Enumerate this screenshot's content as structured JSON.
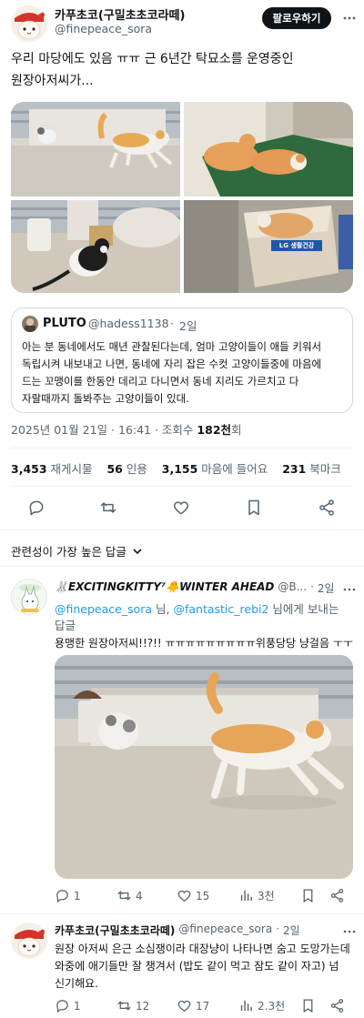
{
  "tweet": {
    "author_name": "카푸초코(구밀초초코라떼)",
    "author_handle": "@finepeace_sora",
    "follow_label": "팔로우하기",
    "text_line1": "우리 마당에도 있음 ㅠㅠ 근 6년간 탁묘소를 운영중인",
    "text_line2": "원장아저씨가...",
    "box_label": "LG 생활건강",
    "quote": {
      "author_name": "PLUTO",
      "author_handle": "@hadess1138",
      "dot": "·",
      "time": "2일",
      "lines": [
        "아는 분 동네에서도 매년 관찰된다는데, 엄마 고양이들이 애들 키워서",
        "독립시켜 내보내고 나면, 동네에 자리 잡은 수컷 고양이들중에 마음에",
        "드는 꼬맹이를 한동안 데리고 다니면서 동네 지리도 가르치고 다",
        "자랄때까지 돌봐주는 고양이들이 있대."
      ]
    },
    "timestamp": "2025년 01월 21일 · 16:41 · 조회수",
    "views": "182천",
    "views_suffix": "회",
    "stats": [
      {
        "num": "3,453",
        "label": "재게시물"
      },
      {
        "num": "56",
        "label": "인용"
      },
      {
        "num": "3,155",
        "label": "마음에 들어요"
      },
      {
        "num": "231",
        "label": "북마크"
      }
    ]
  },
  "sort": {
    "label": "관련성이 가장 높은 답글"
  },
  "reply1": {
    "author_name": "🐰EXCITINGKITTY⁷🐥WINTER AHEAD",
    "author_handle": "@B...",
    "dot": "·",
    "time": "2일",
    "replying_prefix": "",
    "mention1": "@finepeace_sora",
    "mid": " 님, ",
    "mention2": "@fantastic_rebi2",
    "replying_suffix": " 님에게 보내는",
    "replying_line2": "답글",
    "text": "용맹한 원장아저씨!!?!! ㅠㅠㅠㅠㅠㅠㅠㅠㅠ위풍당당 냥걸음 ㅜㅜ",
    "actions": {
      "reply": "1",
      "retweet": "4",
      "like": "15",
      "views": "3천"
    }
  },
  "reply2": {
    "author_name": "카푸초코(구밀초초코라떼)",
    "author_handle": "@finepeace_sora",
    "dot": "·",
    "time": "2일",
    "lines": [
      "원장 아저씨 은근 소심쟁이라 대장냥이 나타나면 숨고 도망가는데",
      "와중에 애기들만 잘 챙겨서 (밥도 같이 먹고 잠도 같이 자고) 넘",
      "신기해요."
    ],
    "actions": {
      "reply": "1",
      "retweet": "12",
      "like": "17",
      "views": "2.3천"
    }
  },
  "colors": {
    "accent": "#1d9bf0",
    "text": "#0f1419",
    "muted": "#536471",
    "border": "#eff3f4"
  }
}
